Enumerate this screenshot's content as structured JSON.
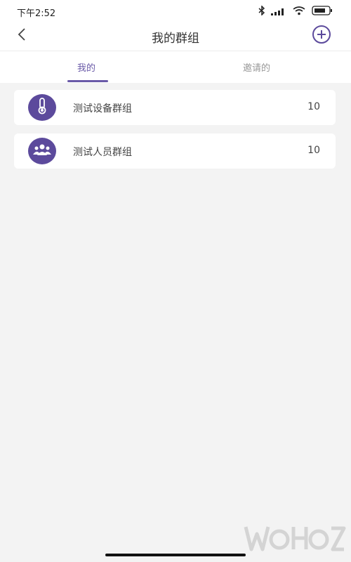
{
  "status_bar": {
    "time": "下午2:52",
    "icons": [
      "bluetooth-icon",
      "signal-icon",
      "wifi-icon",
      "battery-icon"
    ]
  },
  "header": {
    "title": "我的群组",
    "back_icon": "chevron-left-icon",
    "add_icon": "plus-circle-icon"
  },
  "tabs": [
    {
      "label": "我的",
      "active": true
    },
    {
      "label": "邀请的",
      "active": false
    }
  ],
  "groups": [
    {
      "name": "测试设备群组",
      "count": "10",
      "icon": "thermometer-icon"
    },
    {
      "name": "测试人员群组",
      "count": "10",
      "icon": "people-icon"
    }
  ],
  "colors": {
    "accent": "#6a5aa8",
    "icon_bg": "#5c4a9c",
    "background": "#f3f3f3"
  }
}
